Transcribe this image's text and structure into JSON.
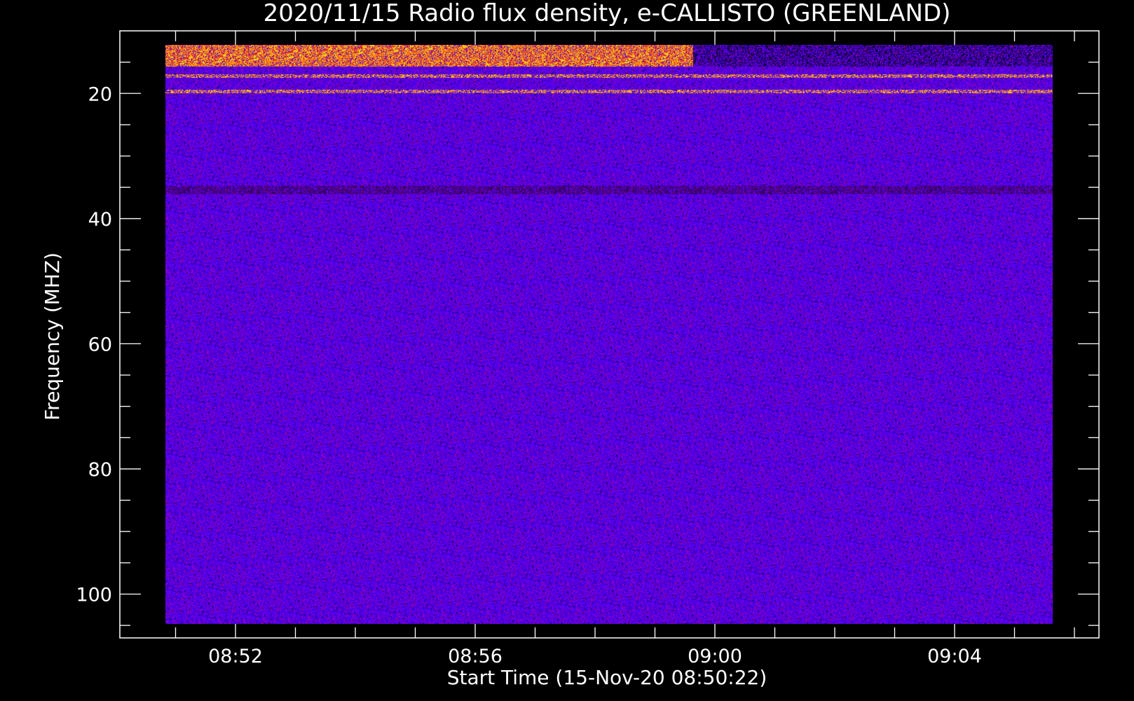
{
  "chart_data": {
    "type": "heatmap",
    "title": "2020/11/15  Radio flux density, e-CALLISTO (GREENLAND)",
    "xlabel": "Start Time (15-Nov-20 08:50:22)",
    "ylabel": "Frequency (MHZ)",
    "x_ticks": [
      "08:52",
      "08:56",
      "09:00",
      "09:04"
    ],
    "x_tick_minutes": [
      1.633,
      5.633,
      9.633,
      13.633
    ],
    "x_minor_step_minutes": 1,
    "x_data_range_minutes": [
      0.77,
      15.68
    ],
    "y_ticks": [
      "20",
      "40",
      "60",
      "80",
      "100"
    ],
    "y_tick_values": [
      20,
      40,
      60,
      80,
      100
    ],
    "y_minor_step": 5,
    "ylim": [
      10,
      107
    ],
    "y_inverted": true,
    "freq_range_mhz": [
      12,
      106
    ],
    "background_level": "blue noise (low intensity)",
    "bright_bands_mhz": [
      12.5,
      13.5,
      14,
      15.5,
      17,
      19.5
    ],
    "bright_band_end_time": "09:00",
    "dark_band_mhz": 35.5,
    "colors": {
      "high": "#ffd040",
      "mid": "#ff3010",
      "low": "#2020ff",
      "axes": "#ffffff",
      "background": "#000000"
    }
  }
}
